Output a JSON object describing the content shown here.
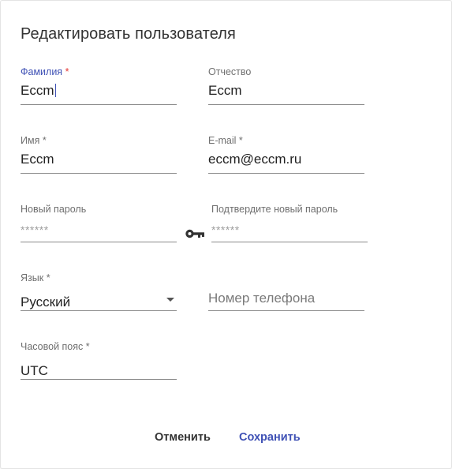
{
  "dialog": {
    "title": "Редактировать пользователя"
  },
  "fields": {
    "last_name": {
      "label": "Фамилия",
      "required_mark": "*",
      "value": "Eccm"
    },
    "middle_name": {
      "label": "Отчество",
      "value": "Eccm"
    },
    "first_name": {
      "label": "Имя",
      "required_mark": "*",
      "value": "Eccm"
    },
    "email": {
      "label": "E-mail",
      "required_mark": "*",
      "value": "eccm@eccm.ru"
    },
    "new_password": {
      "label": "Новый пароль",
      "value": "******"
    },
    "confirm_password": {
      "label": "Подтвердите новый пароль",
      "value": "******"
    },
    "language": {
      "label": "Язык",
      "required_mark": "*",
      "value": "Русский"
    },
    "phone": {
      "placeholder": "Номер телефона"
    },
    "timezone": {
      "label": "Часовой пояс",
      "required_mark": "*",
      "value": "UTC"
    }
  },
  "icons": {
    "password_generator": "key-icon",
    "language_dropdown": "chevron-down-icon"
  },
  "actions": {
    "cancel_label": "Отменить",
    "save_label": "Сохранить"
  },
  "colors": {
    "accent": "#3f51b5",
    "required_focused": "#e53935",
    "text": "#222222",
    "label": "#6f6f6f"
  }
}
